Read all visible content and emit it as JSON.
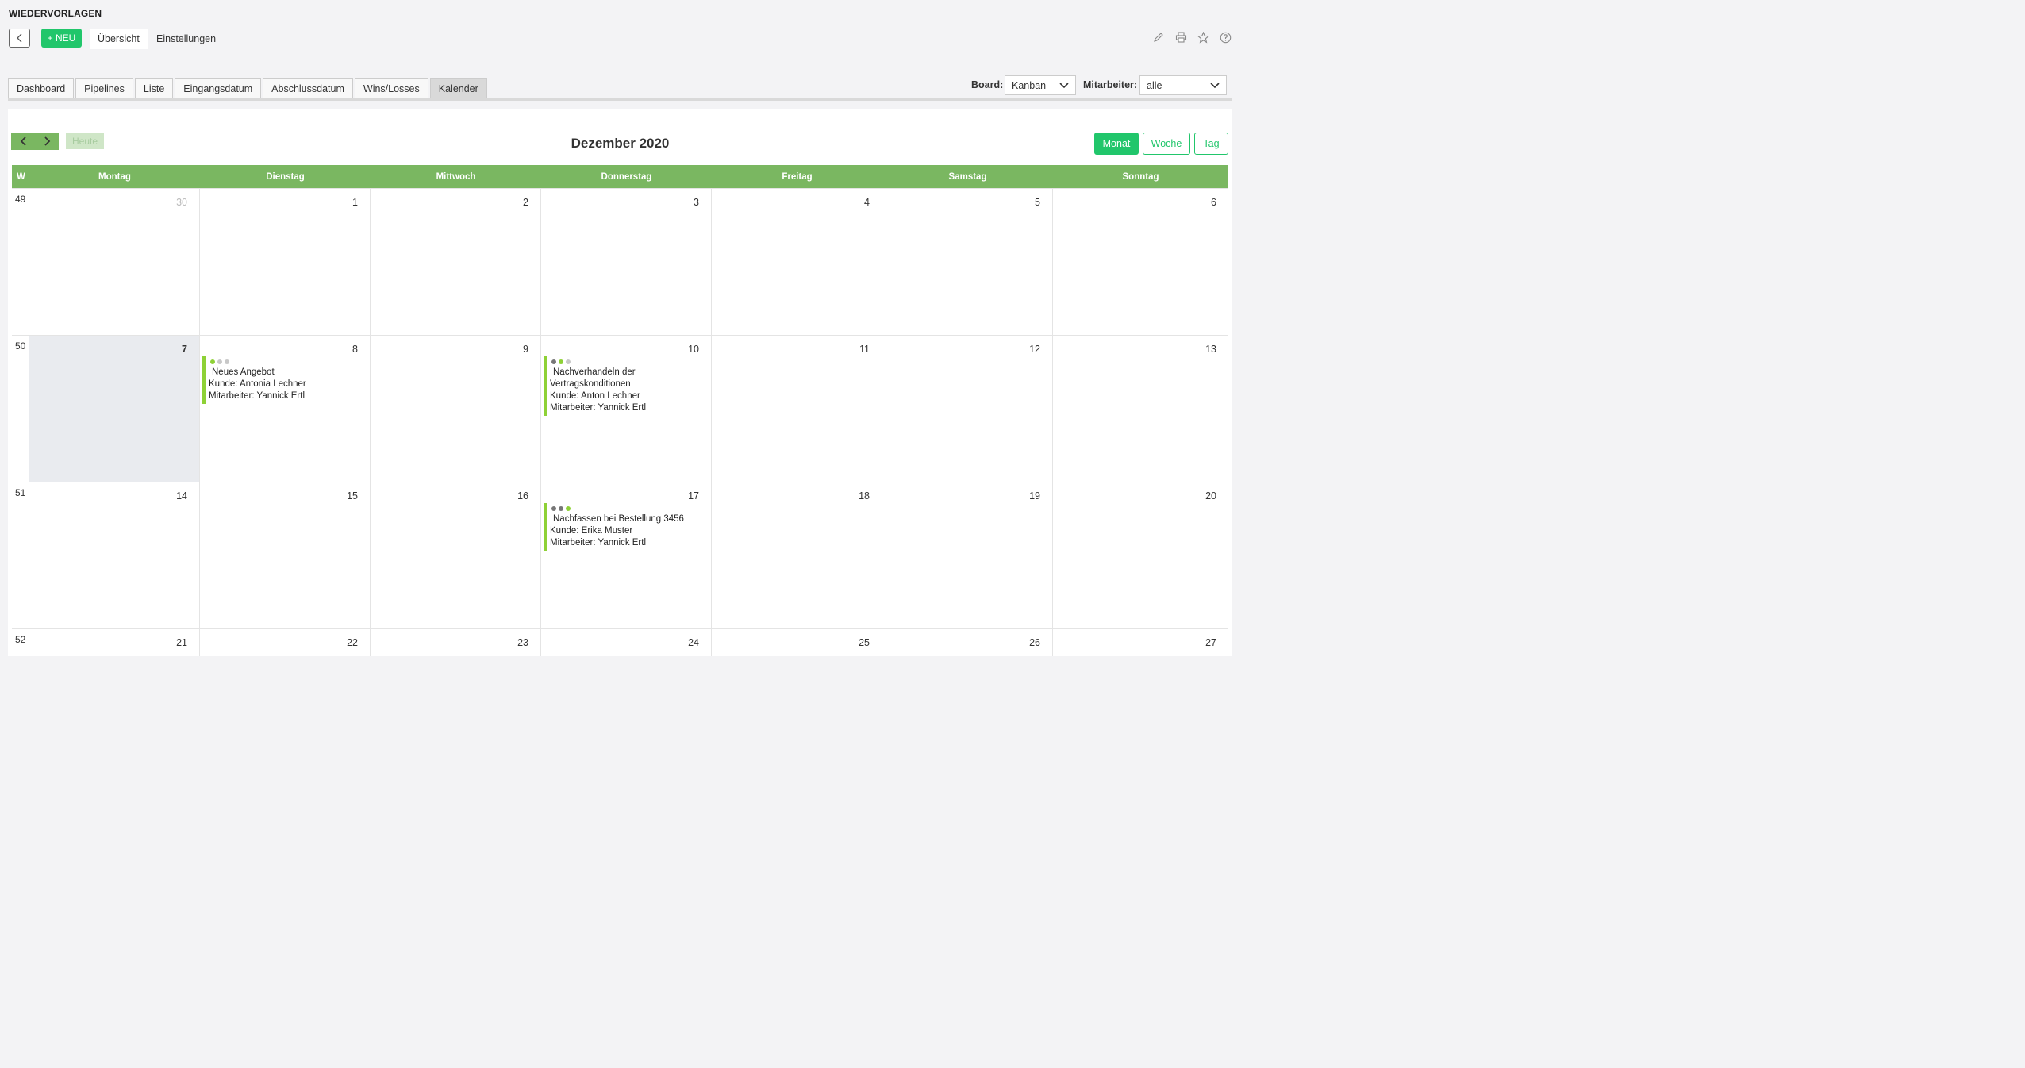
{
  "header": {
    "app_title": "WIEDERVORLAGEN",
    "new_button": "+ NEU",
    "nav_tabs": [
      "Übersicht",
      "Einstellungen"
    ],
    "icons": [
      "pencil-icon",
      "print-icon",
      "star-icon",
      "help-icon"
    ]
  },
  "view_tabs": [
    "Dashboard",
    "Pipelines",
    "Liste",
    "Eingangsdatum",
    "Abschlussdatum",
    "Wins/Losses",
    "Kalender"
  ],
  "active_view_tab": "Kalender",
  "filters": {
    "board_label": "Board:",
    "board_value": "Kanban",
    "employee_label": "Mitarbeiter:",
    "employee_value": "alle"
  },
  "calendar": {
    "title": "Dezember 2020",
    "today_button": "Heute",
    "modes": [
      "Monat",
      "Woche",
      "Tag"
    ],
    "active_mode": "Monat",
    "week_col_label": "W",
    "weekdays": [
      "Montag",
      "Dienstag",
      "Mittwoch",
      "Donnerstag",
      "Freitag",
      "Samstag",
      "Sonntag"
    ],
    "weeks": [
      {
        "week": "49",
        "days": [
          "30",
          "1",
          "2",
          "3",
          "4",
          "5",
          "6"
        ]
      },
      {
        "week": "50",
        "days": [
          "7",
          "8",
          "9",
          "10",
          "11",
          "12",
          "13"
        ]
      },
      {
        "week": "51",
        "days": [
          "14",
          "15",
          "16",
          "17",
          "18",
          "19",
          "20"
        ]
      },
      {
        "week": "52",
        "days": [
          "21",
          "22",
          "23",
          "24",
          "25",
          "26",
          "27"
        ]
      }
    ],
    "events": [
      {
        "title": "Neues Angebot",
        "customer": "Kunde: Antonia Lechner",
        "employee": "Mitarbeiter: Yannick Ertl"
      },
      {
        "title": "Nachverhandeln der",
        "title2": "Vertragskonditionen",
        "customer": "Kunde: Anton Lechner",
        "employee": "Mitarbeiter: Yannick Ertl"
      },
      {
        "title": "Nachfassen bei Bestellung 3456",
        "customer": "Kunde: Erika Muster",
        "employee": "Mitarbeiter: Yannick Ertl"
      }
    ]
  },
  "colors": {
    "accent_green": "#21c66b",
    "header_green": "#7ab761",
    "event_bar": "#8ed136"
  }
}
